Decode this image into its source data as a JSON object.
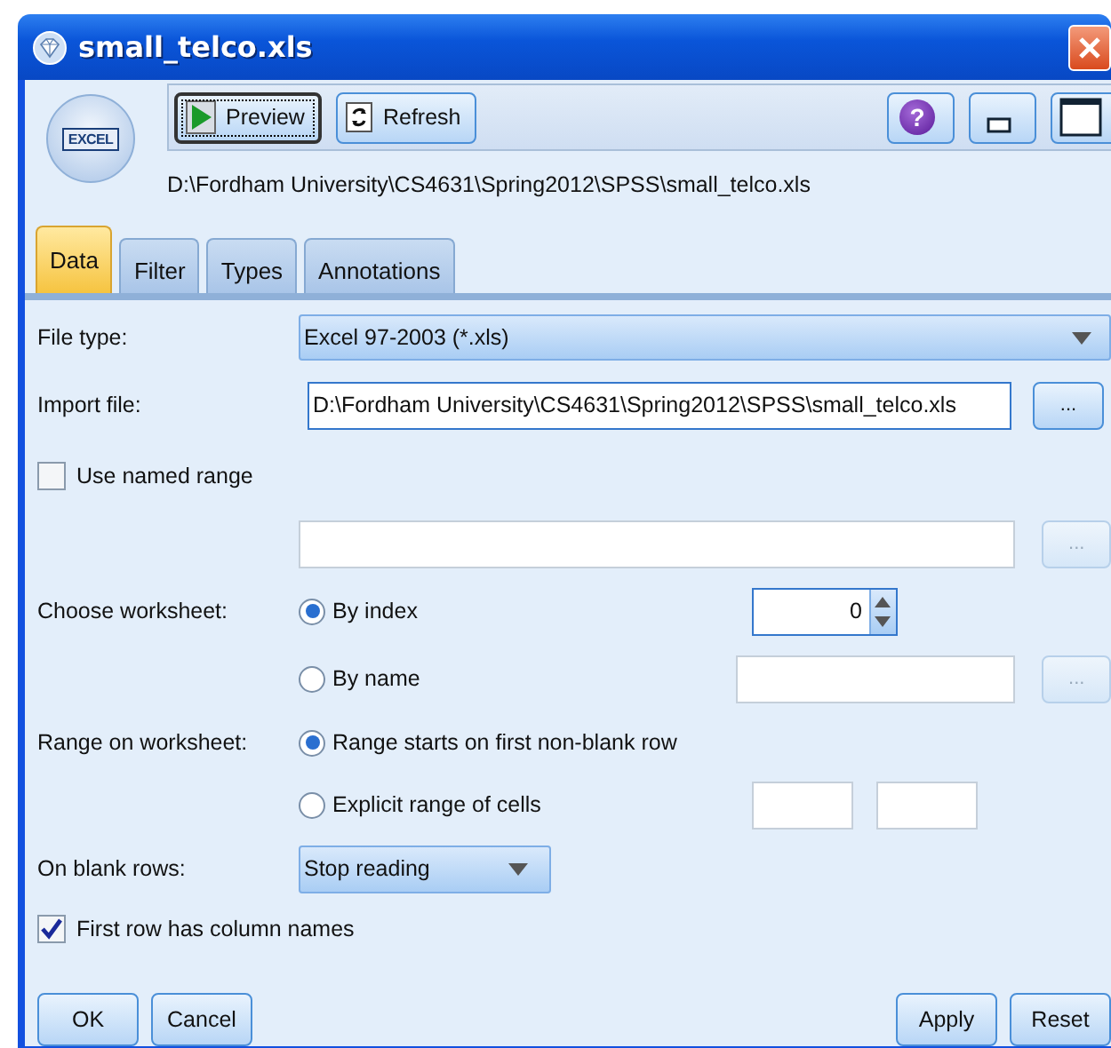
{
  "window": {
    "title": "small_telco.xls"
  },
  "node_icon": {
    "label": "EXCEL"
  },
  "toolbar": {
    "buttons": [
      {
        "label": "Preview",
        "kind": "preview",
        "focused": true
      },
      {
        "label": "Refresh",
        "kind": "refresh",
        "focused": false
      }
    ],
    "help": {
      "label": "?"
    }
  },
  "file_path": "D:\\Fordham University\\CS4631\\Spring2012\\SPSS\\small_telco.xls",
  "tabs": [
    {
      "label": "Data",
      "selected": true
    },
    {
      "label": "Filter",
      "selected": false
    },
    {
      "label": "Types",
      "selected": false
    },
    {
      "label": "Annotations",
      "selected": false
    }
  ],
  "form": {
    "file_type": {
      "label": "File type:",
      "value": "Excel 97-2003 (*.xls)"
    },
    "import_file": {
      "label": "Import file:",
      "value": "D:\\Fordham University\\CS4631\\Spring2012\\SPSS\\small_telco.xls",
      "browse": {
        "label": "...",
        "disabled": false
      }
    },
    "use_named_range": {
      "label": "Use named range",
      "checked": false,
      "browse": {
        "label": "...",
        "disabled": true
      }
    },
    "choose_worksheet": {
      "label": "Choose worksheet:",
      "options": [
        {
          "label": "By index",
          "selected": true
        },
        {
          "label": "By name",
          "selected": false
        }
      ],
      "index_value": "0",
      "browse": {
        "label": "...",
        "disabled": true
      }
    },
    "range_on_worksheet": {
      "label": "Range on worksheet:",
      "options": [
        {
          "label": "Range starts on first non-blank row",
          "selected": true
        },
        {
          "label": "Explicit range of cells",
          "selected": false
        }
      ]
    },
    "on_blank_rows": {
      "label": "On blank rows:",
      "value": "Stop reading"
    },
    "first_row_names": {
      "label": "First row has column names",
      "checked": true
    }
  },
  "buttons": [
    {
      "label": "OK"
    },
    {
      "label": "Cancel"
    },
    {
      "label": "Apply"
    },
    {
      "label": "Reset"
    }
  ]
}
